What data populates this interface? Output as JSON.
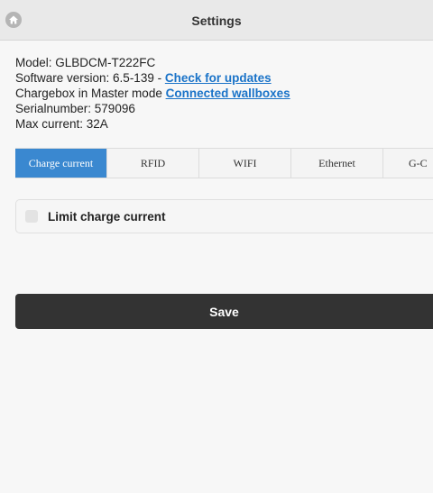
{
  "header": {
    "title": "Settings",
    "home_icon": "home-icon"
  },
  "info": {
    "model": "Model: GLBDCM-T222FC",
    "software_prefix": "Software version: 6.5-139 - ",
    "check_updates_link": "Check for updates",
    "master_prefix": "Chargebox in Master mode ",
    "wallboxes_link": "Connected wallboxes",
    "serial": "Serialnumber: 579096",
    "max_current": "Max current: 32A"
  },
  "tabs": [
    {
      "label": "Charge current",
      "active": true
    },
    {
      "label": "RFID"
    },
    {
      "label": "WIFI"
    },
    {
      "label": "Ethernet"
    },
    {
      "label": "G-C"
    }
  ],
  "option": {
    "label": "Limit charge current",
    "checked": false
  },
  "save_label": "Save",
  "colors": {
    "accent": "#3a88d0",
    "link": "#1a73c8",
    "save_bg": "#333333"
  }
}
